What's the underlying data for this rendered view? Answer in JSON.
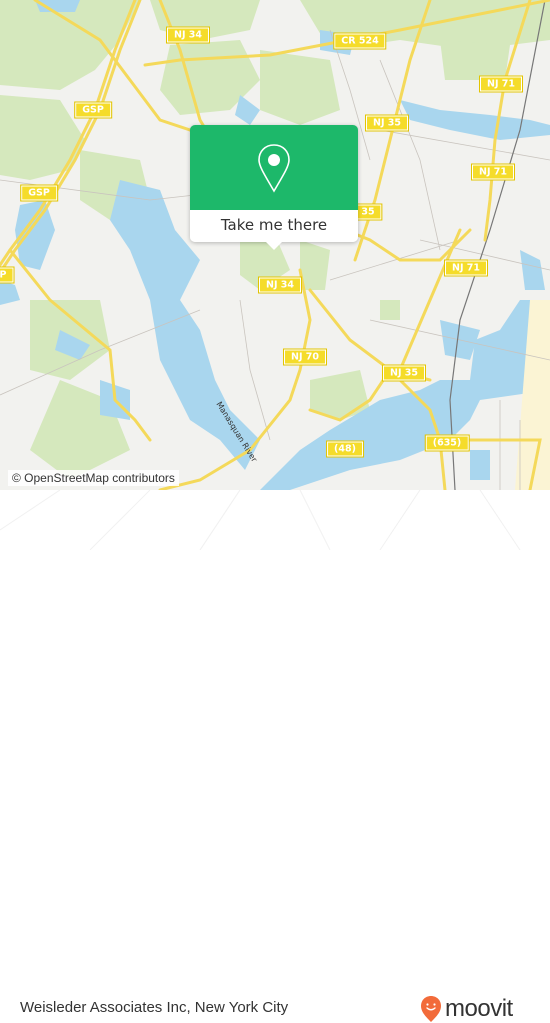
{
  "map": {
    "attribution": "© OpenStreetMap contributors",
    "road_shields": [
      {
        "id": "nj34-top",
        "label": "NJ 34"
      },
      {
        "id": "cr524",
        "label": "CR 524"
      },
      {
        "id": "nj71-a",
        "label": "NJ 71"
      },
      {
        "id": "gsp-a",
        "label": "GSP"
      },
      {
        "id": "nj35-a",
        "label": "NJ 35"
      },
      {
        "id": "gsp-b",
        "label": "GSP"
      },
      {
        "id": "nj71-b",
        "label": "NJ 71"
      },
      {
        "id": "nj71-c",
        "label": "NJ 71"
      },
      {
        "id": "nj34-mid",
        "label": "NJ 34"
      },
      {
        "id": "nj70",
        "label": "NJ 70"
      },
      {
        "id": "nj35-b",
        "label": "NJ 35"
      },
      {
        "id": "r48",
        "label": "(48)"
      },
      {
        "id": "r635",
        "label": "(635)"
      },
      {
        "id": "nj35-partial",
        "label": "35"
      },
      {
        "id": "gsp-partial",
        "label": "P"
      }
    ],
    "river_label": "Manasquan River",
    "colors": {
      "land": "#f2f2ef",
      "water": "#a8d8ef",
      "park": "#cfe6b4",
      "road": "#f7e36b",
      "popup": "#1db86a",
      "brand": "#f26b3a"
    }
  },
  "popup": {
    "button_label": "Take me there",
    "icon": "map-pin-icon"
  },
  "footer": {
    "title": "Weisleder Associates Inc, New York City",
    "brand": "moovit"
  }
}
